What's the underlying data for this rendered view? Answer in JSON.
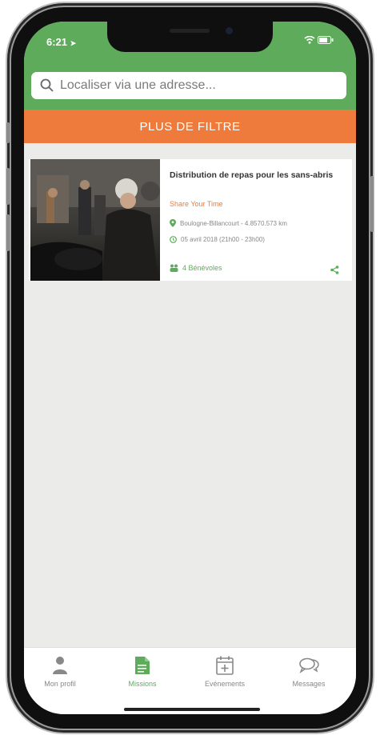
{
  "status_bar": {
    "time": "6:21"
  },
  "search": {
    "placeholder": "Localiser via une adresse..."
  },
  "filter": {
    "label": "PLUS DE FILTRE"
  },
  "mission": {
    "title": "Distribution de repas pour les sans-abris",
    "organization": "Share Your Time",
    "location": "Boulogne-Billancourt - 4.8570.573 km",
    "date": "05 avril 2018 (21h00 - 23h00)",
    "volunteers": "4 Bénévoles"
  },
  "tabs": [
    {
      "label": "Mon profil",
      "icon": "user-icon"
    },
    {
      "label": "Missions",
      "icon": "document-icon"
    },
    {
      "label": "Evénements",
      "icon": "calendar-plus-icon"
    },
    {
      "label": "Messages",
      "icon": "chat-icon"
    }
  ],
  "colors": {
    "green": "#5dab5b",
    "orange": "#ee7b3c",
    "background": "#ebebea"
  }
}
